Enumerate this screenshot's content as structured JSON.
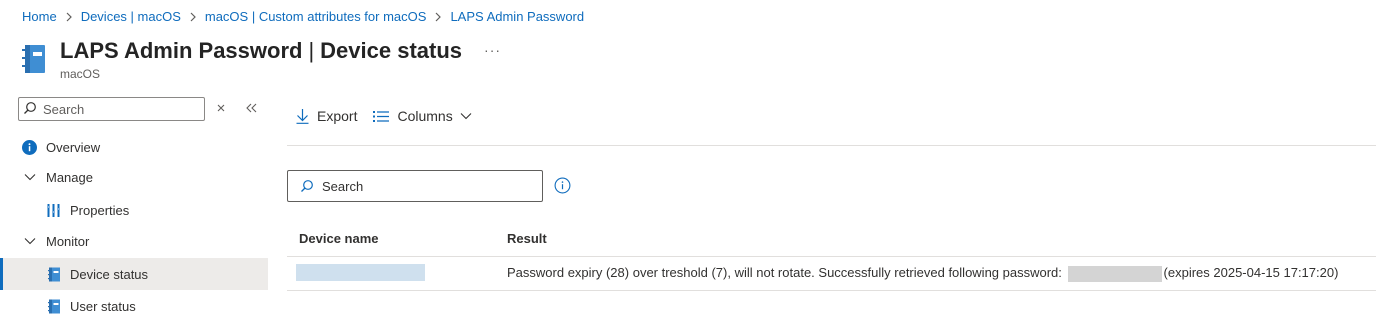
{
  "breadcrumb": [
    "Home",
    "Devices | macOS",
    "macOS | Custom attributes for macOS",
    "LAPS Admin Password"
  ],
  "header": {
    "title_strong": "LAPS Admin Password",
    "title_sep": "|",
    "title_rest": "Device status",
    "more": "···",
    "subtitle": "macOS"
  },
  "sidebar": {
    "search_placeholder": "Search",
    "overview": "Overview",
    "manage": "Manage",
    "properties": "Properties",
    "monitor": "Monitor",
    "device_status": "Device status",
    "user_status": "User status"
  },
  "toolbar": {
    "export": "Export",
    "columns": "Columns"
  },
  "main": {
    "search_placeholder": "Search"
  },
  "table": {
    "headers": [
      "Device name",
      "Result"
    ],
    "rows": [
      {
        "device_name": "",
        "result_prefix": "Password expiry (28) over treshold (7), will not rotate. Successfully retrieved following password:",
        "result_suffix": "(expires 2025-04-15 17:17:20)"
      }
    ]
  },
  "colors": {
    "accent": "#0f6cbd",
    "selected_bg": "#edebe9",
    "redacted_name": "#cfe0ee",
    "redacted_password": "#d4d4d4"
  }
}
